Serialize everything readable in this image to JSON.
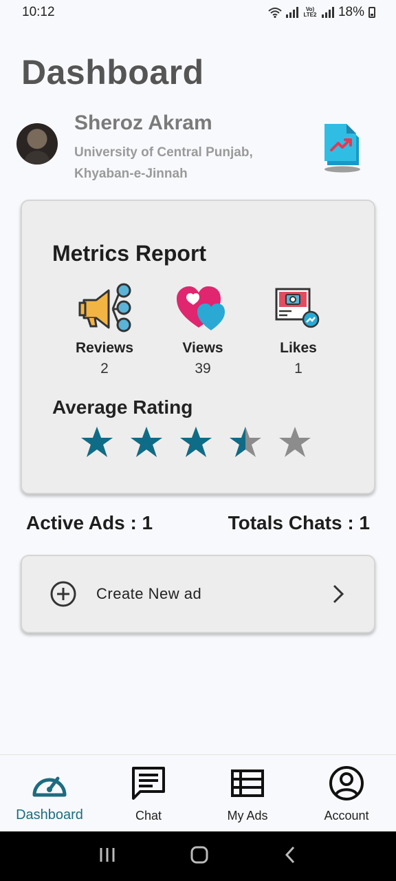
{
  "status_bar": {
    "time": "10:12",
    "network_label": "Vo) LTE2",
    "battery": "18%"
  },
  "page": {
    "title": "Dashboard"
  },
  "profile": {
    "name": "Sheroz Akram",
    "address_line1": "University of Central Punjab,",
    "address_line2": "Khyaban-e-Jinnah",
    "icons": {
      "avatar": "profile-photo",
      "report": "report-chart-icon"
    }
  },
  "metrics": {
    "title": "Metrics Report",
    "items": [
      {
        "label": "Reviews",
        "value": "2",
        "icon": "megaphone-icon"
      },
      {
        "label": "Views",
        "value": "39",
        "icon": "hearts-icon"
      },
      {
        "label": "Likes",
        "value": "1",
        "icon": "camera-screen-icon"
      }
    ],
    "rating_title": "Average Rating",
    "rating": {
      "value": 3.5,
      "max": 5
    }
  },
  "stats": {
    "active_ads": "Active Ads : 1",
    "total_chats": "Totals Chats : 1"
  },
  "create": {
    "label": "Create New ad",
    "icons": [
      "add-circle-icon",
      "chevron-right-icon"
    ]
  },
  "nav": [
    {
      "label": "Dashboard",
      "icon": "speedometer-icon",
      "active": true
    },
    {
      "label": "Chat",
      "icon": "chat-icon",
      "active": false
    },
    {
      "label": "My Ads",
      "icon": "list-icon",
      "active": false
    },
    {
      "label": "Account",
      "icon": "account-circle-icon",
      "active": false
    }
  ],
  "colors": {
    "accent": "#1d6c80",
    "star_filled": "#0f6c86",
    "star_empty": "#8c8c8c",
    "heart_pink": "#e0266f",
    "heart_blue": "#29a9d4"
  }
}
